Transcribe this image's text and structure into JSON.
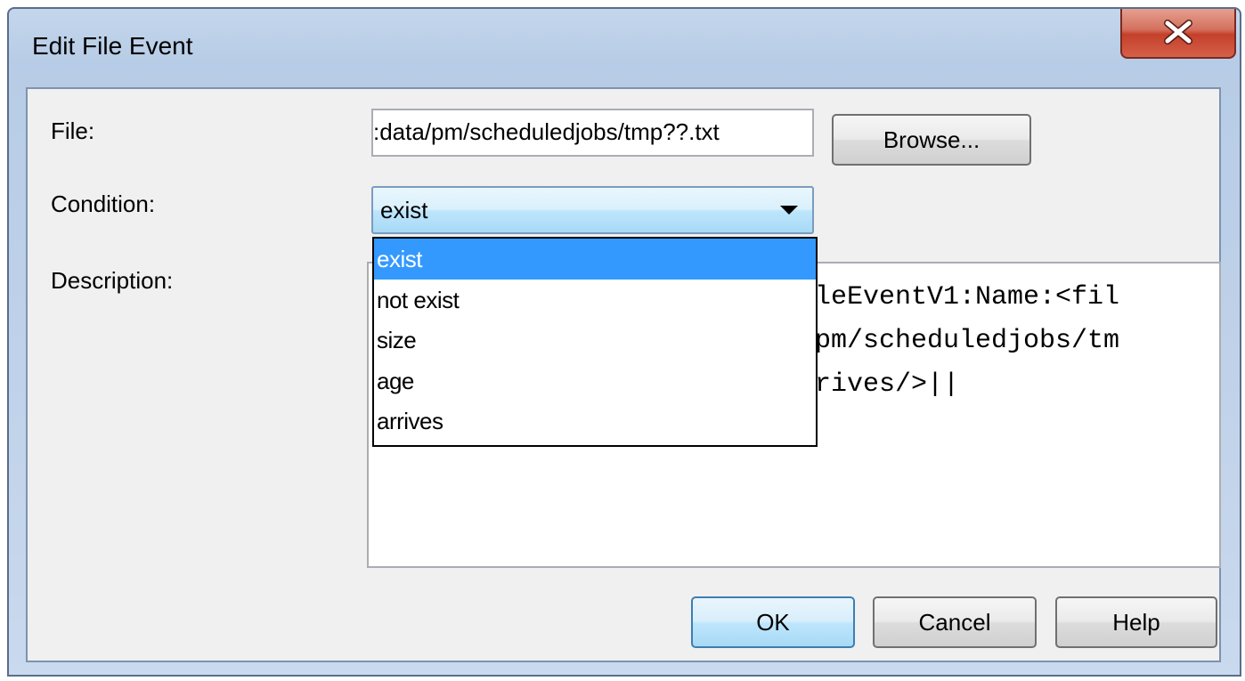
{
  "window": {
    "title": "Edit File Event",
    "close_label": "X"
  },
  "form": {
    "file_label": "File:",
    "file_value": ":data/pm/scheduledjobs/tmp??.txt",
    "browse_label": "Browse...",
    "condition_label": "Condition:",
    "condition_value": "exist",
    "description_label": "Description:",
    "description_lines": [
      "leEventV1:Name:<fil",
      "pm/scheduledjobs/tm",
      "rives/>||"
    ]
  },
  "dropdown": {
    "options": [
      "exist",
      "not exist",
      "size",
      "age",
      "arrives"
    ],
    "selected_index": 0
  },
  "buttons": {
    "ok_label": "OK",
    "cancel_label": "Cancel",
    "help_label": "Help"
  },
  "icons": {
    "close": "close-icon",
    "dropdown_arrow": "chevron-down-icon"
  }
}
